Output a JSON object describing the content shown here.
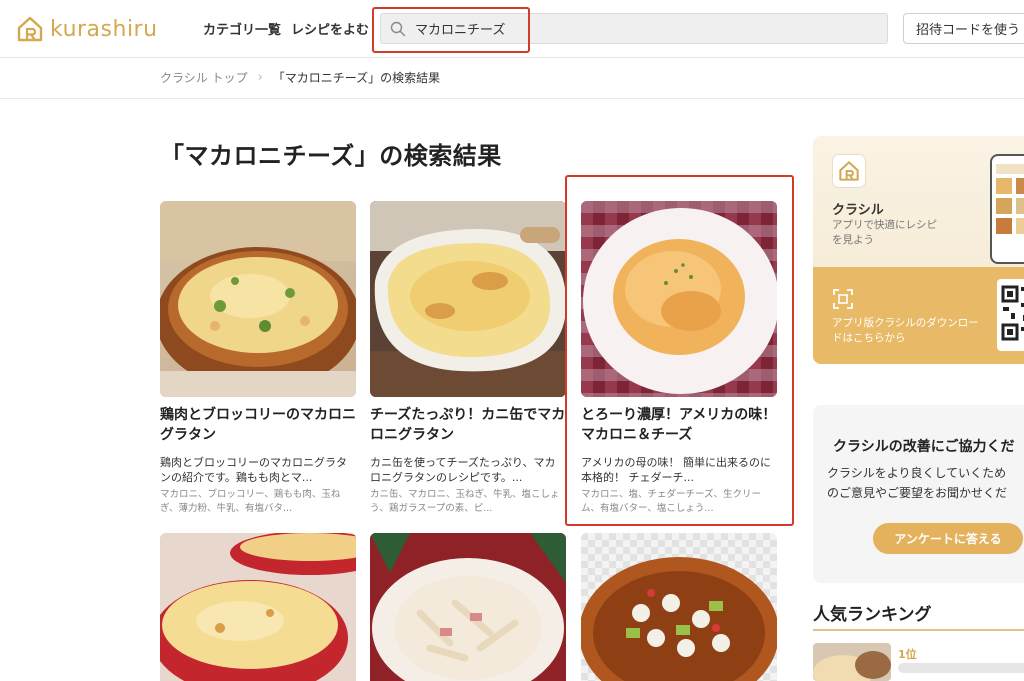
{
  "header": {
    "logo_text": "kurashiru",
    "nav": [
      "カテゴリ一覧",
      "レシピをよむ"
    ],
    "search_value": "マカロニチーズ",
    "invite_label": "招待コードを使う"
  },
  "breadcrumb": {
    "home": "クラシル トップ",
    "current": "「マカロニチーズ」の検索結果"
  },
  "page_title": "「マカロニチーズ」の検索結果",
  "recipes": [
    {
      "title": "鶏肉とブロッコリーのマカロニグラタン",
      "desc": "鶏肉とブロッコリーのマカロニグラタンの紹介です。鶏もも肉とマ...",
      "ingredients": "マカロニ、ブロッコリー、鶏もも肉、玉ねぎ、薄力粉、牛乳、有塩バタ..."
    },
    {
      "title": "チーズたっぷり！カニ缶でマカロニグラタン",
      "desc": "カニ缶を使ってチーズたっぷり、マカロニグラタンのレシピです。...",
      "ingredients": "カニ缶、マカロニ、玉ねぎ、牛乳、塩こしょう、鶏ガラスープの素、ピ..."
    },
    {
      "title": "とろーり濃厚！アメリカの味！マカロニ＆チーズ",
      "desc": "アメリカの母の味！ 簡単に出来るのに本格的！ チェダーチ...",
      "ingredients": "マカロニ、塩、チェダーチーズ、生クリーム、有塩バター、塩こしょう..."
    }
  ],
  "sidebar": {
    "app_name": "クラシル",
    "app_sub": "アプリで快適にレシピを見よう",
    "app_download": "アプリ版クラシルのダウンロードはこちらから",
    "survey_heading": "クラシルの改善にご協力くだ",
    "survey_text_1": "クラシルをより良くしていくため",
    "survey_text_2": "のご意見やご要望をお聞かせくだ",
    "survey_button": "アンケートに答える",
    "ranking_title": "人気ランキング",
    "rank_1": "1位"
  },
  "colors": {
    "brand": "#d3a84e",
    "highlight": "#d23a2a",
    "button": "#e4b15d"
  }
}
